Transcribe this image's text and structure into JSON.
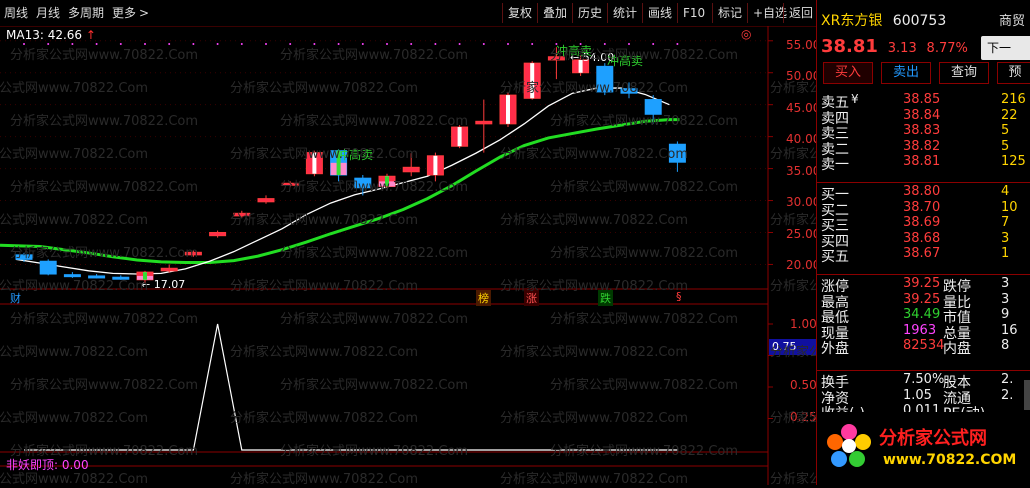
{
  "toolbar": {
    "period_week": "周线",
    "period_month": "月线",
    "period_multi": "多周期",
    "more": "更多",
    "more_icon": "chevron-right",
    "buttons": [
      "复权",
      "叠加",
      "历史",
      "统计",
      "画线",
      "F10",
      "标记",
      "+自选",
      "返回"
    ]
  },
  "indicator_top": {
    "ma_label": "MA13: 42.66",
    "arrow": "↑"
  },
  "annotations": {
    "max_price": "54.00",
    "min_price": "17.07",
    "signal_1": "冲高卖",
    "signal_2": "冲高卖",
    "signal_3": "冲高卖"
  },
  "event_markers": {
    "cai": "财",
    "bang": "榜",
    "zhang": "涨",
    "die": "跌",
    "s": "§"
  },
  "price_axis": [
    "55.00",
    "50.00",
    "45.00",
    "40.00",
    "35.00",
    "30.00",
    "25.00",
    "20.00"
  ],
  "sub_axis": [
    "1.00",
    "0.75",
    "0.50",
    "0.25"
  ],
  "sub_current": "0.75",
  "sub_indicator": {
    "label": "非妖即顶: 0.00"
  },
  "watermark": "分析家公式网www.70822.Com",
  "chart_data": {
    "type": "candlestick",
    "ylim": [
      16,
      57
    ],
    "candles": [
      {
        "o": 21.5,
        "c": 20.8,
        "h": 21.8,
        "l": 20.4
      },
      {
        "o": 20.5,
        "c": 18.5,
        "h": 20.8,
        "l": 18.3
      },
      {
        "o": 18.4,
        "c": 18.1,
        "h": 18.8,
        "l": 17.9
      },
      {
        "o": 18.2,
        "c": 18.0,
        "h": 18.5,
        "l": 17.8
      },
      {
        "o": 18.0,
        "c": 17.8,
        "h": 18.3,
        "l": 17.6
      },
      {
        "o": 17.6,
        "c": 18.8,
        "h": 19.0,
        "l": 17.07
      },
      {
        "o": 19.0,
        "c": 19.4,
        "h": 20.0,
        "l": 18.7
      },
      {
        "o": 21.5,
        "c": 21.9,
        "h": 22.2,
        "l": 21.2
      },
      {
        "o": 24.5,
        "c": 25.0,
        "h": 25.3,
        "l": 24.2
      },
      {
        "o": 27.6,
        "c": 28.0,
        "h": 28.4,
        "l": 27.3
      },
      {
        "o": 29.8,
        "c": 30.3,
        "h": 30.8,
        "l": 29.5
      },
      {
        "o": 32.4,
        "c": 32.7,
        "h": 33.0,
        "l": 32.1
      },
      {
        "o": 34.2,
        "c": 37.5,
        "h": 37.8,
        "l": 33.8
      },
      {
        "o": 37.8,
        "c": 34.0,
        "h": 38.0,
        "l": 33.0
      },
      {
        "o": 33.5,
        "c": 32.0,
        "h": 34.0,
        "l": 30.8
      },
      {
        "o": 32.2,
        "c": 33.8,
        "h": 34.2,
        "l": 32.0
      },
      {
        "o": 34.5,
        "c": 35.2,
        "h": 37.4,
        "l": 33.8
      },
      {
        "o": 34.0,
        "c": 37.0,
        "h": 37.5,
        "l": 33.0
      },
      {
        "o": 38.5,
        "c": 41.5,
        "h": 41.8,
        "l": 38.2
      },
      {
        "o": 42.0,
        "c": 42.4,
        "h": 45.8,
        "l": 37.5
      },
      {
        "o": 42.0,
        "c": 46.5,
        "h": 47.0,
        "l": 41.5
      },
      {
        "o": 46.0,
        "c": 51.5,
        "h": 51.8,
        "l": 45.8
      },
      {
        "o": 52.0,
        "c": 52.5,
        "h": 54.0,
        "l": 49.0
      },
      {
        "o": 50.0,
        "c": 52.0,
        "h": 52.8,
        "l": 49.5
      },
      {
        "o": 51.0,
        "c": 47.0,
        "h": 51.5,
        "l": 46.5
      },
      {
        "o": 47.5,
        "c": 46.8,
        "h": 48.5,
        "l": 46.0
      },
      {
        "o": 45.8,
        "c": 43.5,
        "h": 46.5,
        "l": 42.0
      },
      {
        "o": 38.81,
        "c": 36.0,
        "h": 39.25,
        "l": 34.49
      }
    ],
    "ma13": [
      20.8,
      20.2,
      19.6,
      19.0,
      18.6,
      18.5,
      18.6,
      19.3,
      20.5,
      22.0,
      23.8,
      25.6,
      27.8,
      29.6,
      30.9,
      31.8,
      32.8,
      33.8,
      35.5,
      37.4,
      39.5,
      42.0,
      44.8,
      46.8,
      47.6,
      47.6,
      46.6,
      45.0
    ],
    "ma_long": [
      23.0,
      22.8,
      22.3,
      21.8,
      21.2,
      20.7,
      20.4,
      20.3,
      20.3,
      20.6,
      21.3,
      22.3,
      23.5,
      24.8,
      26.0,
      27.2,
      28.6,
      30.3,
      32.3,
      34.6,
      36.8,
      38.6,
      39.8,
      40.5,
      41.2,
      41.8,
      42.4,
      42.66
    ],
    "sub_series": [
      0,
      0,
      0,
      0,
      0,
      0,
      0,
      0,
      1,
      0,
      0,
      0,
      0,
      0,
      0,
      0,
      0,
      0,
      0,
      0,
      0,
      0,
      0,
      0,
      0,
      0,
      0,
      0
    ]
  },
  "quote": {
    "name": "XR东方银",
    "code": "600753",
    "truncated_right": "商贸",
    "price": "38.81",
    "change": "3.13",
    "change_pct": "8.77%",
    "next_btn": "下一",
    "buy_btn": "买入",
    "sell_btn": "卖出",
    "query_btn": "查询",
    "pre_btn": "预",
    "asks": [
      {
        "label": "卖五",
        "mark": "¥",
        "price": "38.85",
        "vol": "216"
      },
      {
        "label": "卖四",
        "mark": "",
        "price": "38.84",
        "vol": "22"
      },
      {
        "label": "卖三",
        "mark": "",
        "price": "38.83",
        "vol": "5"
      },
      {
        "label": "卖二",
        "mark": "",
        "price": "38.82",
        "vol": "5"
      },
      {
        "label": "卖一",
        "mark": "",
        "price": "38.81",
        "vol": "125"
      }
    ],
    "bids": [
      {
        "label": "买一",
        "price": "38.80",
        "vol": "4"
      },
      {
        "label": "买二",
        "price": "38.70",
        "vol": "10"
      },
      {
        "label": "买三",
        "price": "38.69",
        "vol": "7"
      },
      {
        "label": "买四",
        "price": "38.68",
        "vol": "3"
      },
      {
        "label": "买五",
        "price": "38.67",
        "vol": "1"
      }
    ],
    "stats": [
      {
        "l1": "涨停",
        "v1": "39.25",
        "l2": "跌停",
        "v2": "3"
      },
      {
        "l1": "最高",
        "v1": "39.25",
        "l2": "量比",
        "v2": "3"
      },
      {
        "l1": "最低",
        "v1": "34.49",
        "l2": "市值",
        "v2": "9"
      },
      {
        "l1": "现量",
        "v1": "1963",
        "l2": "总量",
        "v2": "16"
      },
      {
        "l1": "外盘",
        "v1": "82534",
        "l2": "内盘",
        "v2": "8"
      }
    ],
    "stats2": [
      {
        "l1": "换手",
        "v1": "7.50%",
        "l2": "股本",
        "v2": "2."
      },
      {
        "l1": "净资",
        "v1": "1.05",
        "l2": "流通",
        "v2": "2."
      },
      {
        "l1": "收益(-)",
        "v1": "0.011",
        "l2": "PE(动)",
        "v2": ""
      }
    ],
    "logo_text": "分析家公式网",
    "logo_url": "www.70822.COM"
  }
}
